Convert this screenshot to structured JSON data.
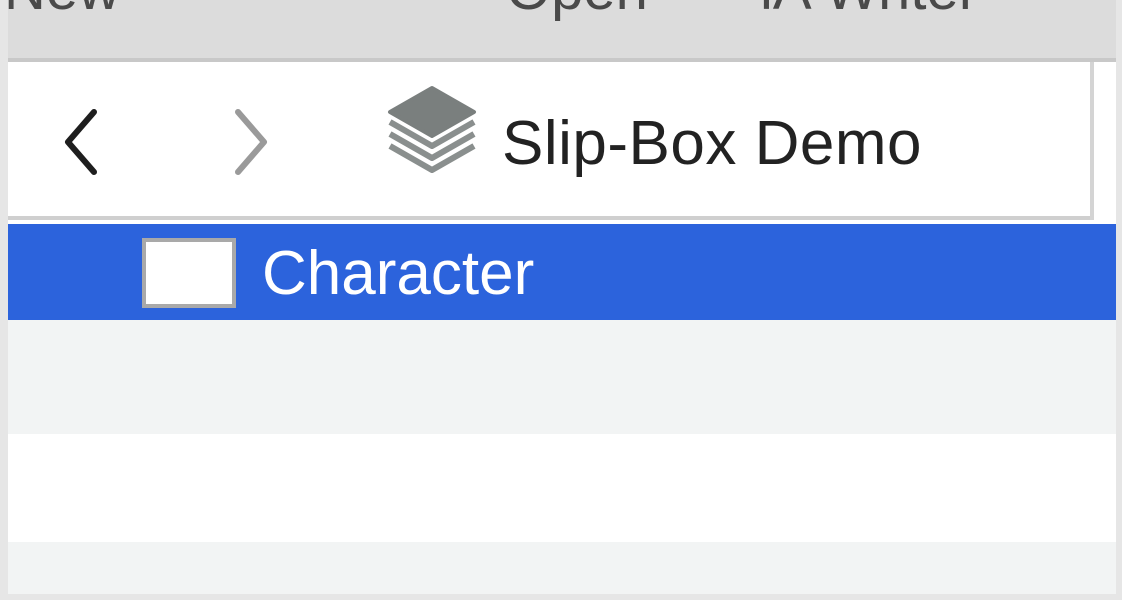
{
  "toolbar": {
    "new_label": "New",
    "open_label": "Open",
    "app_label": "iA Writer"
  },
  "header": {
    "back_icon": "chevron-left-icon",
    "forward_icon": "chevron-right-icon",
    "library_icon": "layers-stack-icon",
    "title": "Slip-Box Demo"
  },
  "list": {
    "items": [
      {
        "label": "Character",
        "selected": true
      }
    ]
  },
  "colors": {
    "selection": "#2c63dc",
    "row_alt": "#f2f4f4",
    "text_dark": "#222222"
  }
}
